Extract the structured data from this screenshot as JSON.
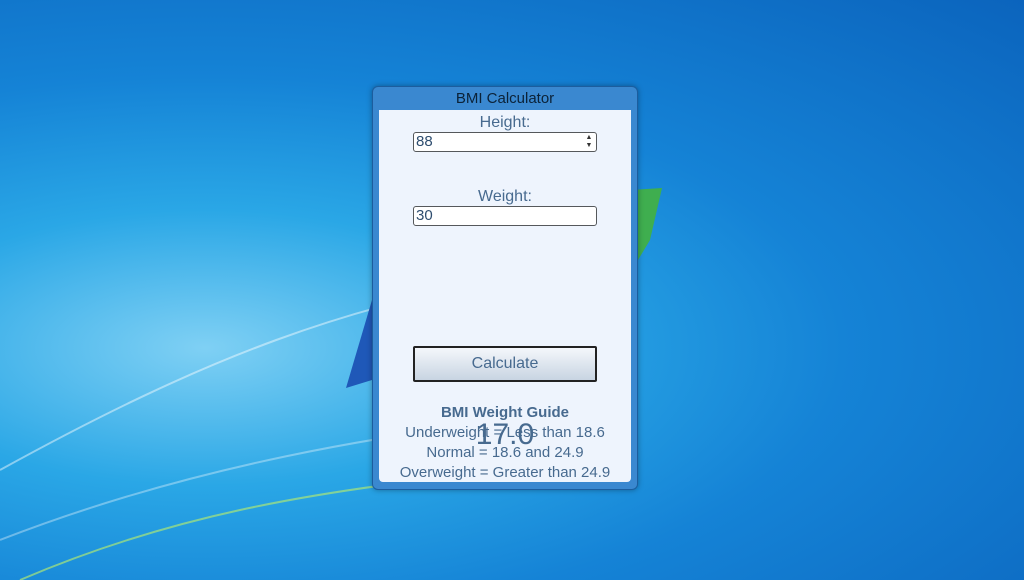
{
  "window": {
    "title": "BMI Calculator"
  },
  "form": {
    "height_label": "Height:",
    "height_value": "88",
    "weight_label": "Weight:",
    "weight_value": "30",
    "calculate_label": "Calculate"
  },
  "result": {
    "bmi": "17.0"
  },
  "guide": {
    "title": "BMI Weight Guide",
    "lines": [
      "Underweight = Less than 18.6",
      "Normal = 18.6 and 24.9",
      "Overweight = Greater than 24.9"
    ]
  },
  "colors": {
    "accent": "#476a8f",
    "frame": "#3a88d0",
    "client_bg": "#eef4fd"
  },
  "icons": {
    "spinner": "spinner-arrows-icon"
  }
}
